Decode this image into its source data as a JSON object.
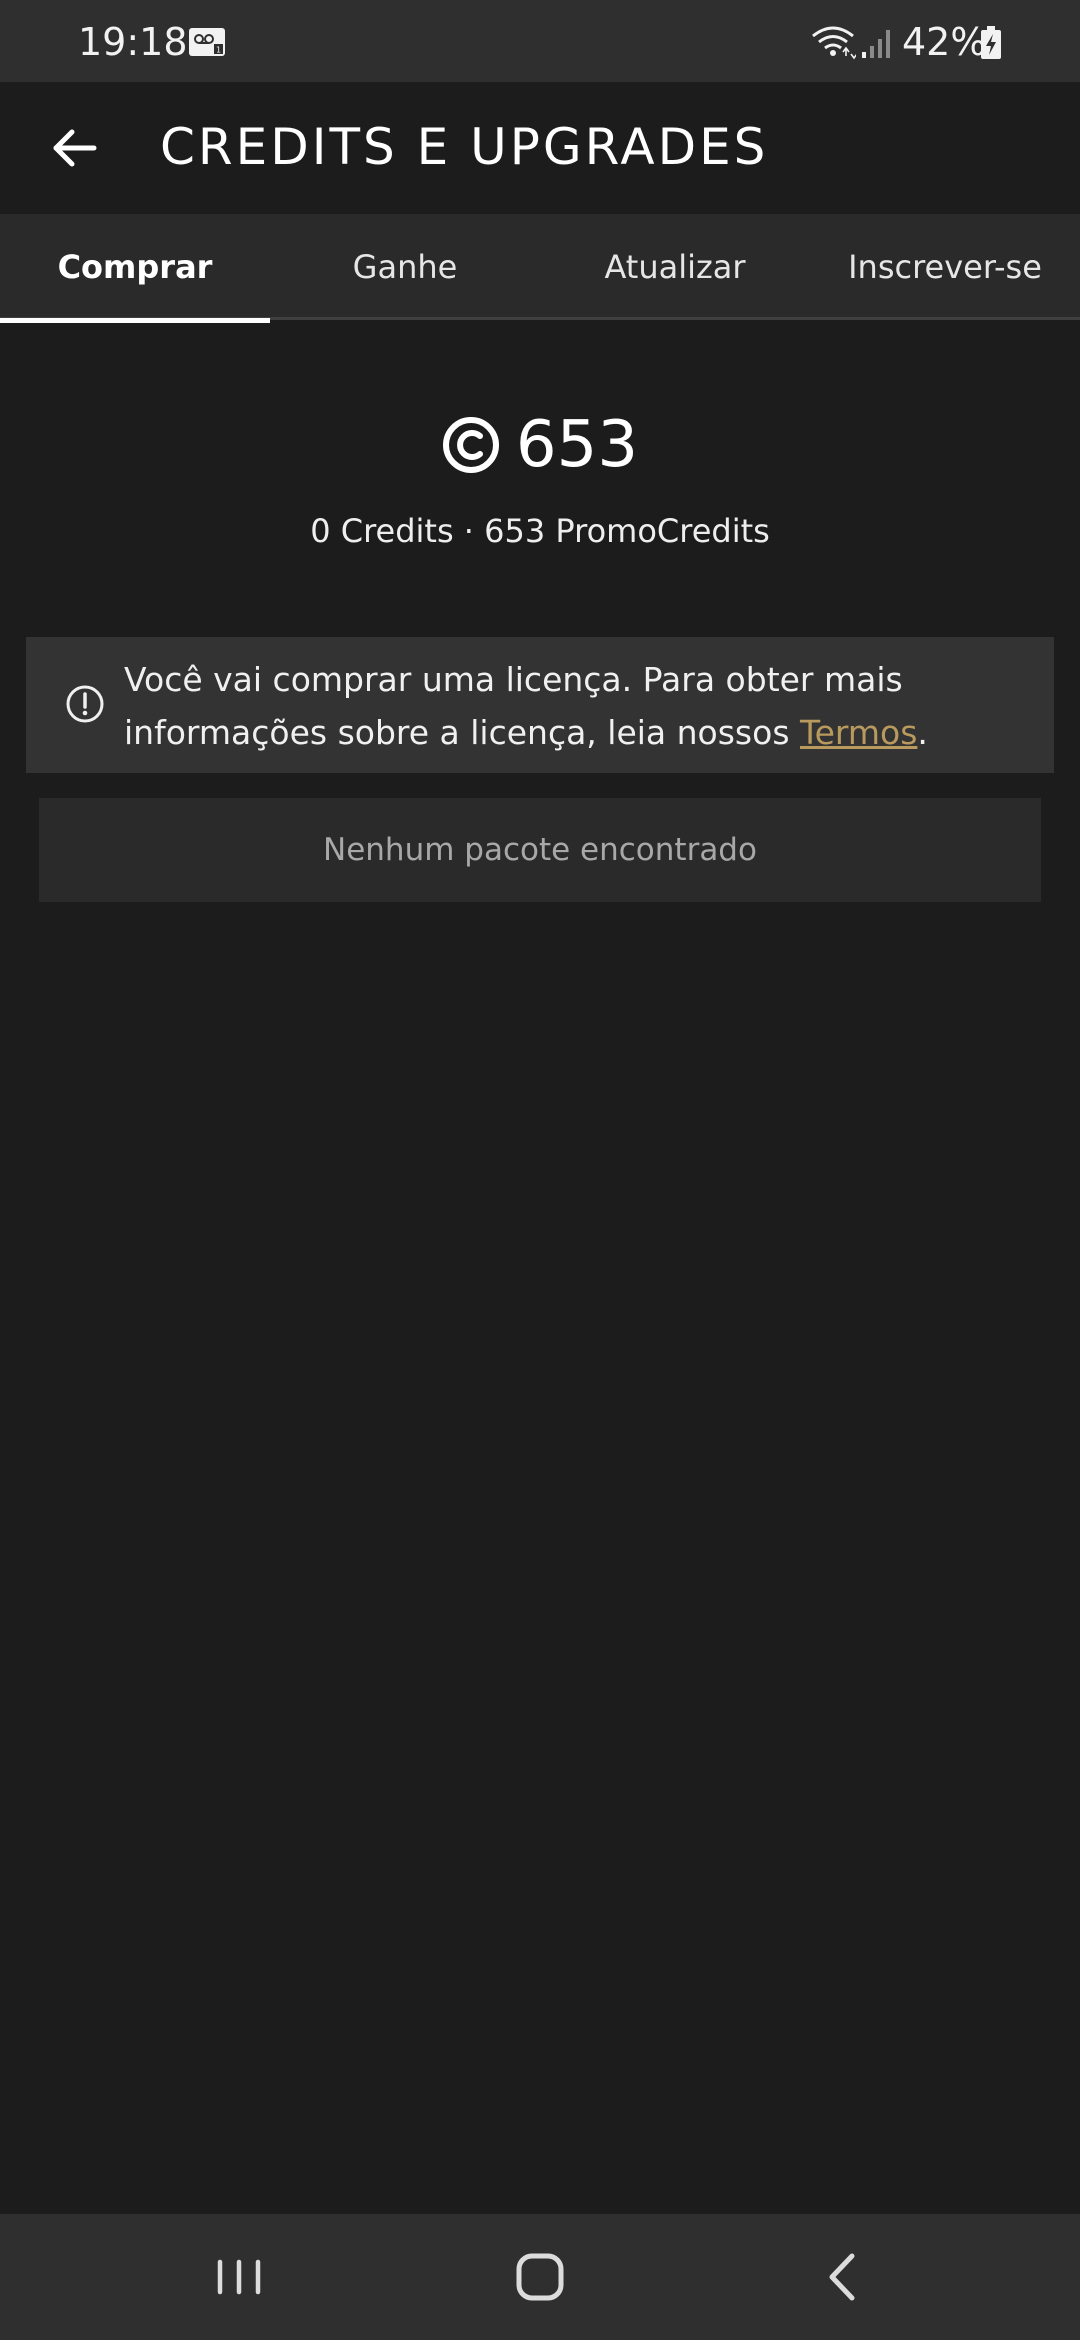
{
  "status_bar": {
    "time": "19:18",
    "battery": "42%",
    "icons": [
      "voicemail-icon",
      "wifi-icon",
      "signal-icon",
      "battery-charging-icon"
    ]
  },
  "app_bar": {
    "title": "CREDITS E UPGRADES",
    "back_icon": "arrow-left-icon"
  },
  "tabs": [
    {
      "label": "Comprar",
      "active": true
    },
    {
      "label": "Ganhe",
      "active": false
    },
    {
      "label": "Atualizar",
      "active": false
    },
    {
      "label": "Inscrever-se",
      "active": false
    }
  ],
  "balance": {
    "icon": "credit-icon",
    "value": "653",
    "credits": "0 Credits",
    "separator": "·",
    "promo_credits": "653 PromoCredits"
  },
  "info_banner": {
    "icon": "info-icon",
    "text": "Você vai comprar uma licença. Para obter mais informações sobre a licença, leia nossos",
    "link_text": "Termos",
    "suffix": "."
  },
  "empty_state": {
    "text": "Nenhum pacote encontrado"
  },
  "navigation_bar": {
    "icons": [
      "recent-apps-icon",
      "home-icon",
      "back-icon"
    ]
  },
  "colors": {
    "background": "#1c1c1c",
    "status_bar": "#2f2f2f",
    "tab_bar": "#2a2a2a",
    "banner": "#333333",
    "link": "#b89a5e",
    "muted_text": "#a8a8a8"
  }
}
